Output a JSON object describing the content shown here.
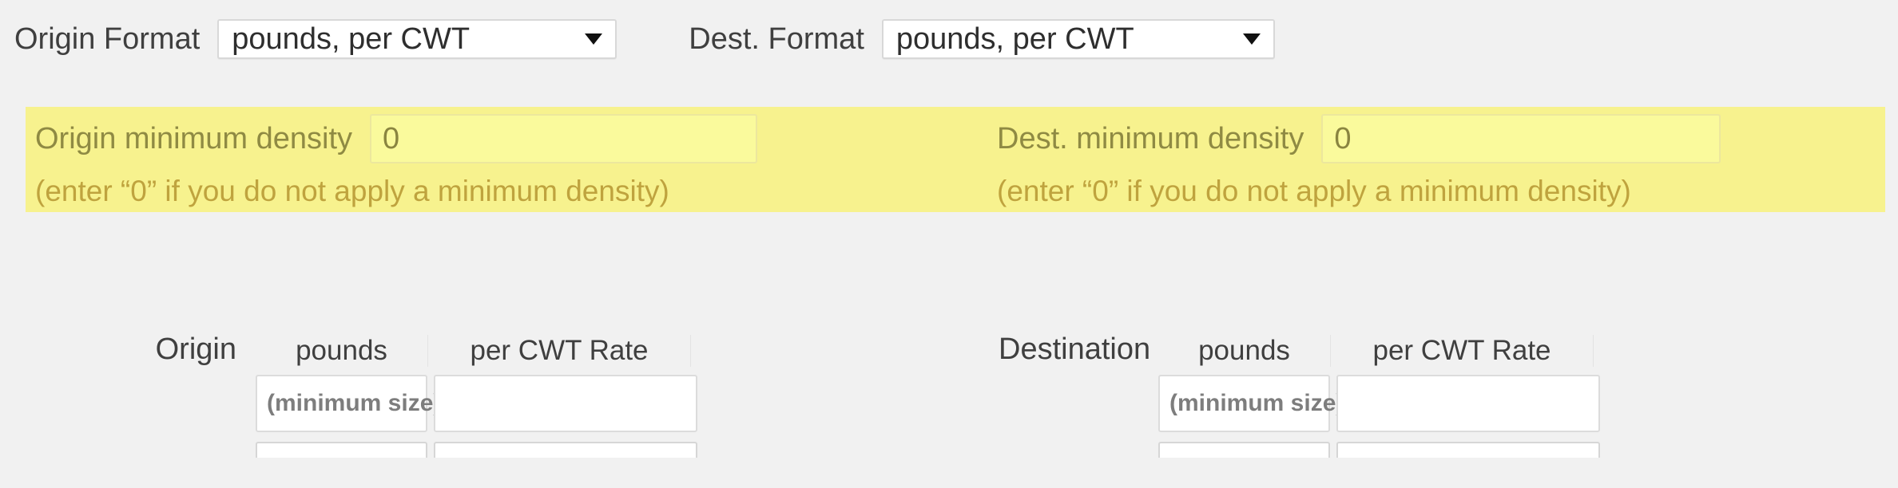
{
  "format_row": {
    "origin": {
      "label": "Origin Format",
      "selected": "pounds, per CWT",
      "arrow_icon": "chevron-down-icon"
    },
    "dest": {
      "label": "Dest. Format",
      "selected": "pounds, per CWT",
      "arrow_icon": "chevron-down-icon"
    }
  },
  "density_panel": {
    "background_color": "#f7f28e",
    "origin": {
      "label": "Origin minimum density",
      "value": "0",
      "hint": "(enter “0” if you do not apply a minimum density)"
    },
    "dest": {
      "label": "Dest. minimum density",
      "value": "0",
      "hint": "(enter “0” if you do not apply a minimum density)"
    }
  },
  "rate_tables": {
    "origin": {
      "side_header": "Origin",
      "pounds_header": "pounds",
      "rate_header": "per CWT Rate",
      "rows": [
        {
          "pounds": "(minimum size)",
          "rate": ""
        },
        {
          "pounds": "",
          "rate": ""
        }
      ]
    },
    "dest": {
      "side_header": "Destination",
      "pounds_header": "pounds",
      "rate_header": "per CWT Rate",
      "rows": [
        {
          "pounds": "(minimum size)",
          "rate": ""
        },
        {
          "pounds": "",
          "rate": ""
        }
      ]
    }
  },
  "colors": {
    "page_background": "#f1f1f1",
    "highlight_yellow": "#f7f28e",
    "input_yellow": "#fafa9c",
    "label_olive": "#8f8a43",
    "hint_olive": "#bfa33e",
    "text_dark": "#3f3f3f"
  }
}
